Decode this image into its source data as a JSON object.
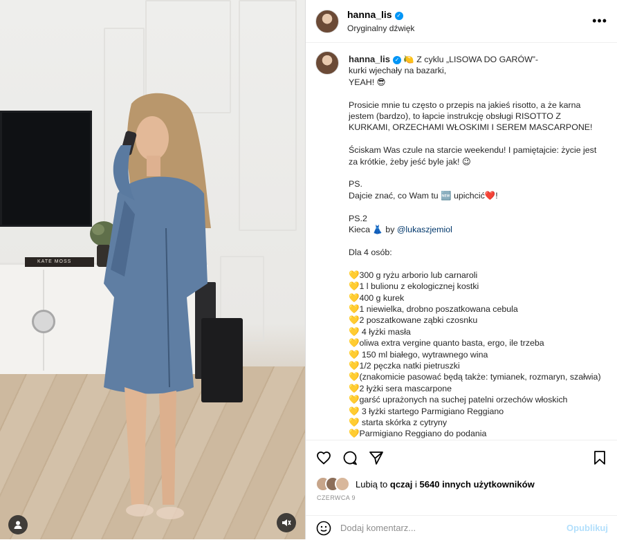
{
  "post": {
    "username": "hanna_lis",
    "audio": "Oryginalny dźwięk"
  },
  "video": {
    "book_title": "KATE MOSS"
  },
  "caption": {
    "username": "hanna_lis",
    "text_1": "🍋 Z cyklu „LISOWA DO GARÓW”- \nkurki wjechały na bazarki,\nYEAH! 😎\n\nProsicie mnie tu często o przepis na jakieś risotto, a że karna jestem (bardzo), to łapcie instrukcję obsługi RISOTTO Z KURKAMI, ORZECHAMI WŁOSKIMI I SEREM MASCARPONE!\n\nŚciskam Was czule na starcie weekendu! I pamiętajcie: życie jest za krótkie, żeby jeść byle jak! 😉\n\nPS.\nDajcie znać, co Wam tu 🆕 upichcić❤️!\n\nPS.2\nKieca 👗 by ",
    "mention": "@lukaszjemiol",
    "text_2": "\n\nDla 4 osób:\n\n",
    "ingredients": [
      "300 g ryżu arborio lub carnaroli",
      "1 l bulionu z ekologicznej kostki",
      "400 g kurek",
      "1 niewielka, drobno poszatkowana cebula",
      "2 poszatkowane ząbki czosnku",
      " 4 łyżki masła",
      "oliwa extra vergine quanto basta, ergo, ile trzeba",
      " 150 ml białego, wytrawnego wina",
      "1/2 pęczka natki pietruszki",
      "(znakomicie pasować będą także: tymianek, rozmaryn, szałwia)",
      "2 łyżki sera mascarpone",
      "garść uprażonych na suchej patelni orzechów włoskich",
      " 3 łyżki startego Parmigiano Reggiano",
      " starta skórka z cytryny",
      "Parmigiano Reggiano do podania"
    ]
  },
  "likes": {
    "prefix": "Lubią to",
    "user": "qczaj",
    "middle": "i",
    "others": "5640 innych użytkowników"
  },
  "date": "CZERWCA 9",
  "comment": {
    "placeholder": "Dodaj komentarz...",
    "post_label": "Opublikuj"
  },
  "colors": {
    "verified": "#0095f6",
    "link": "#00376b",
    "heart": "#f2c811",
    "post_disabled": "#b2dffc"
  }
}
